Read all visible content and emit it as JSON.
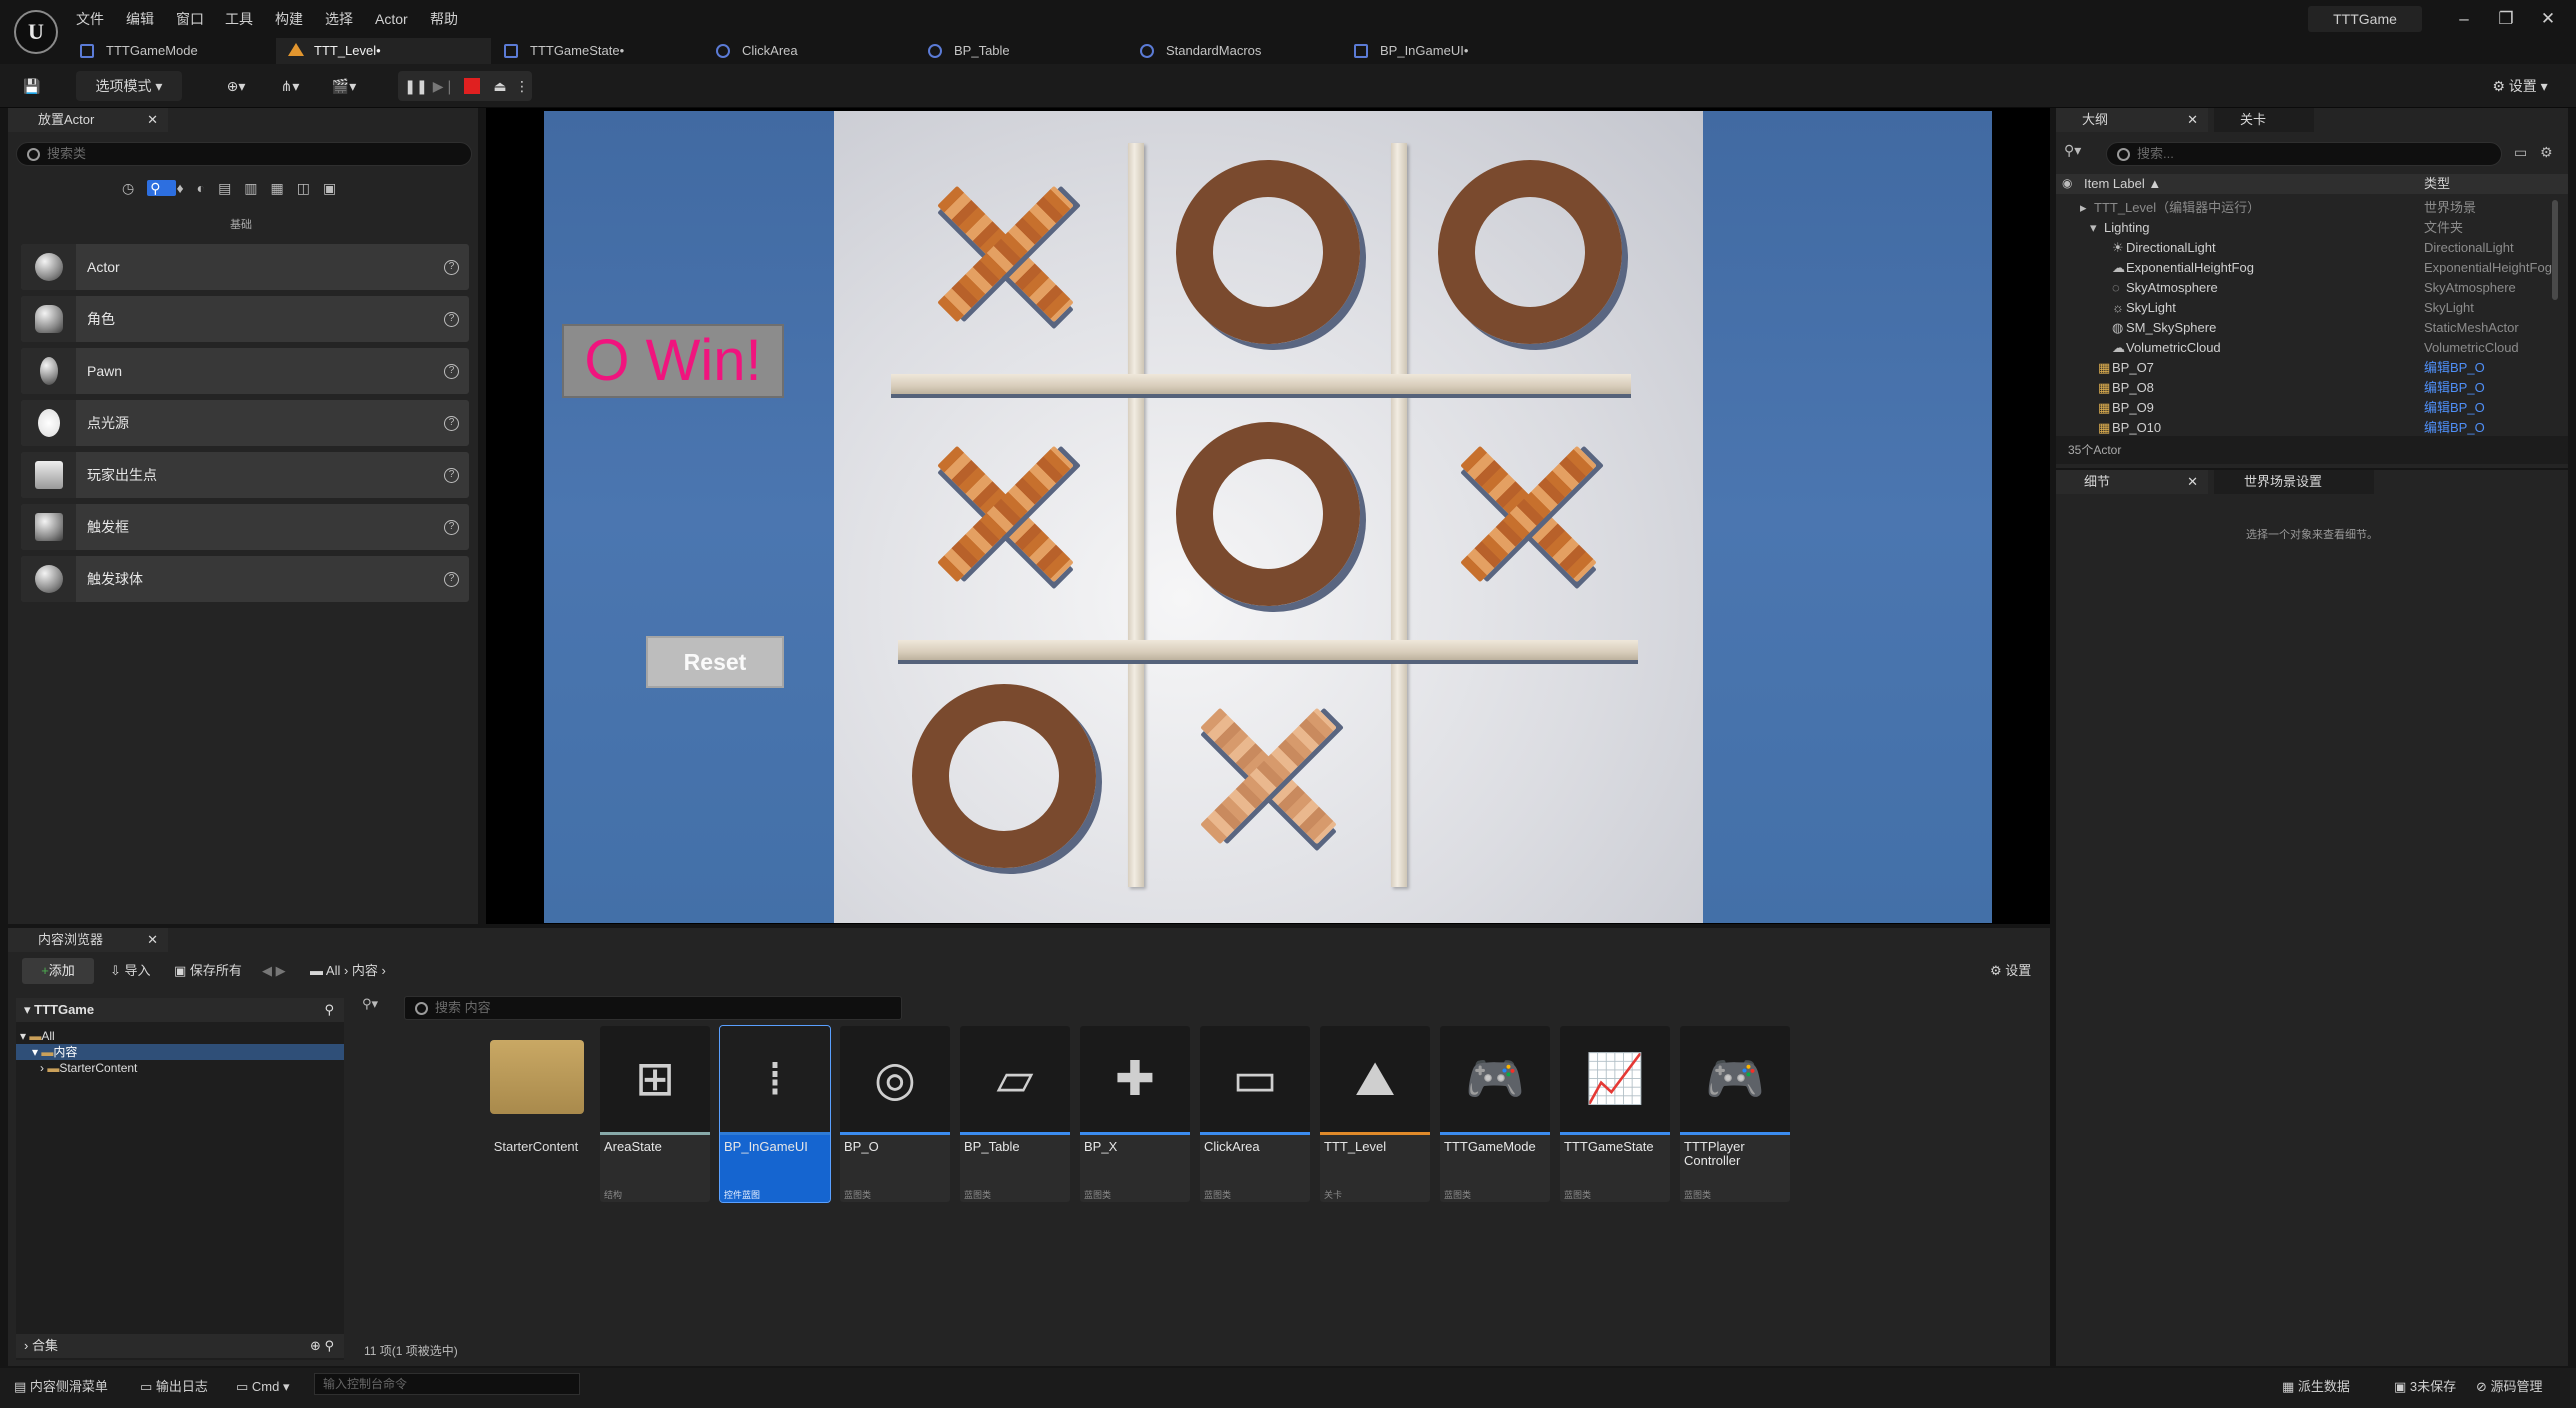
{
  "menu": [
    "文件",
    "编辑",
    "窗口",
    "工具",
    "构建",
    "选择",
    "Actor",
    "帮助"
  ],
  "project_name": "TTTGame",
  "tabs": [
    {
      "label": "TTTGameMode"
    },
    {
      "label": "TTT_Level•"
    },
    {
      "label": "TTTGameState•"
    },
    {
      "label": "ClickArea"
    },
    {
      "label": "BP_Table"
    },
    {
      "label": "StandardMacros"
    },
    {
      "label": "BP_InGameUI•"
    }
  ],
  "toolbar": {
    "mode_label": "选项模式",
    "settings_label": "设置"
  },
  "place_actors": {
    "title": "放置Actor",
    "search_placeholder": "搜索类",
    "category": "基础",
    "items": [
      "Actor",
      "角色",
      "Pawn",
      "点光源",
      "玩家出生点",
      "触发框",
      "触发球体"
    ]
  },
  "viewport": {
    "win_text": "O Win!",
    "reset_label": "Reset",
    "board": [
      [
        "X",
        "O",
        "O"
      ],
      [
        "X",
        "O",
        "X"
      ],
      [
        "O",
        "X",
        ""
      ]
    ]
  },
  "outliner": {
    "tab1": "大纲",
    "tab2": "关卡",
    "search_placeholder": "搜索...",
    "col_label": "Item Label ▲",
    "col_type": "类型",
    "rows": [
      {
        "label": "TTT_Level（编辑器中运行）",
        "type": "世界场景"
      },
      {
        "label": "Lighting",
        "type": "文件夹"
      },
      {
        "label": "DirectionalLight",
        "type": "DirectionalLight"
      },
      {
        "label": "ExponentialHeightFog",
        "type": "ExponentialHeightFog"
      },
      {
        "label": "SkyAtmosphere",
        "type": "SkyAtmosphere"
      },
      {
        "label": "SkyLight",
        "type": "SkyLight"
      },
      {
        "label": "SM_SkySphere",
        "type": "StaticMeshActor"
      },
      {
        "label": "VolumetricCloud",
        "type": "VolumetricCloud"
      },
      {
        "label": "BP_O7",
        "type": "编辑BP_O"
      },
      {
        "label": "BP_O8",
        "type": "编辑BP_O"
      },
      {
        "label": "BP_O9",
        "type": "编辑BP_O"
      },
      {
        "label": "BP_O10",
        "type": "编辑BP_O"
      }
    ],
    "count": "35个Actor"
  },
  "details": {
    "tab1": "细节",
    "tab2": "世界场景设置",
    "empty": "选择一个对象来查看细节。"
  },
  "content_browser": {
    "title": "内容浏览器",
    "add": "添加",
    "import": "导入",
    "save_all": "保存所有",
    "path": [
      "All",
      "内容"
    ],
    "settings": "设置",
    "tree_root": "TTTGame",
    "tree": [
      "All",
      "内容",
      "StarterContent"
    ],
    "search_placeholder": "搜索 内容",
    "collections": "合集",
    "status": "11 项(1 项被选中)",
    "assets": [
      {
        "name": "StarterContent",
        "type": ""
      },
      {
        "name": "AreaState",
        "type": "结构"
      },
      {
        "name": "BP_InGameUI",
        "type": "控件蓝图"
      },
      {
        "name": "BP_O",
        "type": "蓝图类"
      },
      {
        "name": "BP_Table",
        "type": "蓝图类"
      },
      {
        "name": "BP_X",
        "type": "蓝图类"
      },
      {
        "name": "ClickArea",
        "type": "蓝图类"
      },
      {
        "name": "TTT_Level",
        "type": "关卡"
      },
      {
        "name": "TTTGameMode",
        "type": "蓝图类"
      },
      {
        "name": "TTTGameState",
        "type": "蓝图类"
      },
      {
        "name": "TTTPlayer Controller",
        "type": "蓝图类"
      }
    ]
  },
  "statusbar": {
    "drawer": "内容侧滑菜单",
    "log": "输出日志",
    "cmd": "Cmd",
    "console_placeholder": "输入控制台命令",
    "source": "派生数据",
    "unsaved": "3未保存",
    "revision": "源码管理"
  }
}
